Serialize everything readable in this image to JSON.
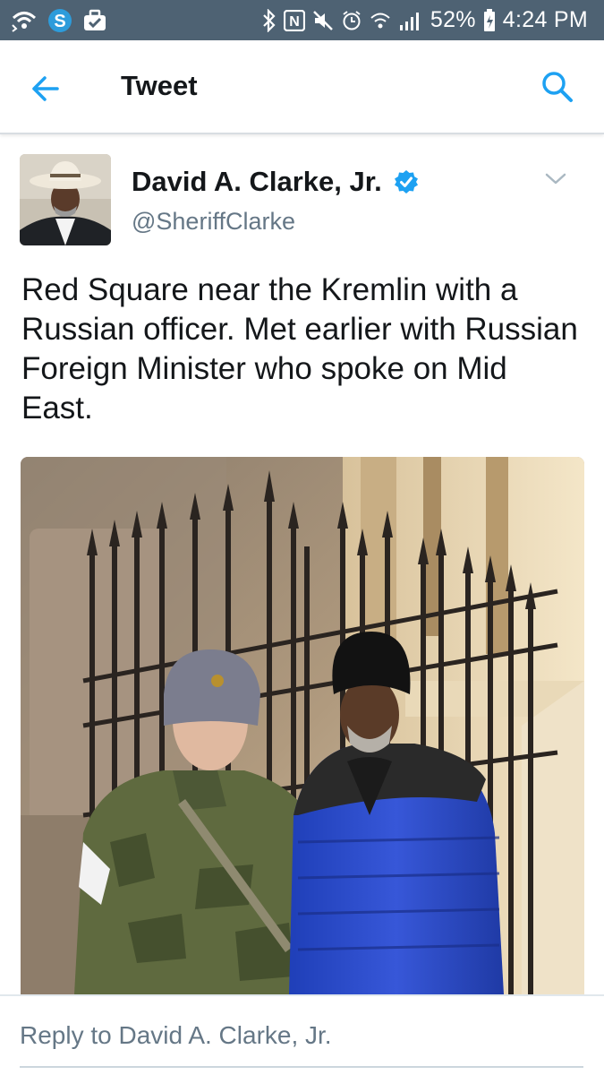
{
  "status_bar": {
    "battery_percent": "52%",
    "time": "4:24 PM",
    "left_icons": [
      "wifi-calling-icon",
      "sync-icon",
      "briefcase-icon"
    ],
    "right_icons": [
      "bluetooth-icon",
      "nfc-icon",
      "mute-icon",
      "alarm-icon",
      "wifi-icon",
      "signal-icon",
      "battery-icon"
    ]
  },
  "app_bar": {
    "title": "Tweet",
    "back_icon": "arrow-left-icon",
    "search_icon": "search-icon",
    "accent_color": "#1da1f2"
  },
  "tweet": {
    "author": {
      "name": "David A. Clarke, Jr.",
      "handle": "@SheriffClarke",
      "verified": true
    },
    "text": "Red Square near the Kremlin with a Russian officer. Met earlier with Russian Foreign Minister who spoke on Mid East.",
    "has_photo": true
  },
  "reply_bar": {
    "placeholder": "Reply to David A. Clarke, Jr."
  }
}
